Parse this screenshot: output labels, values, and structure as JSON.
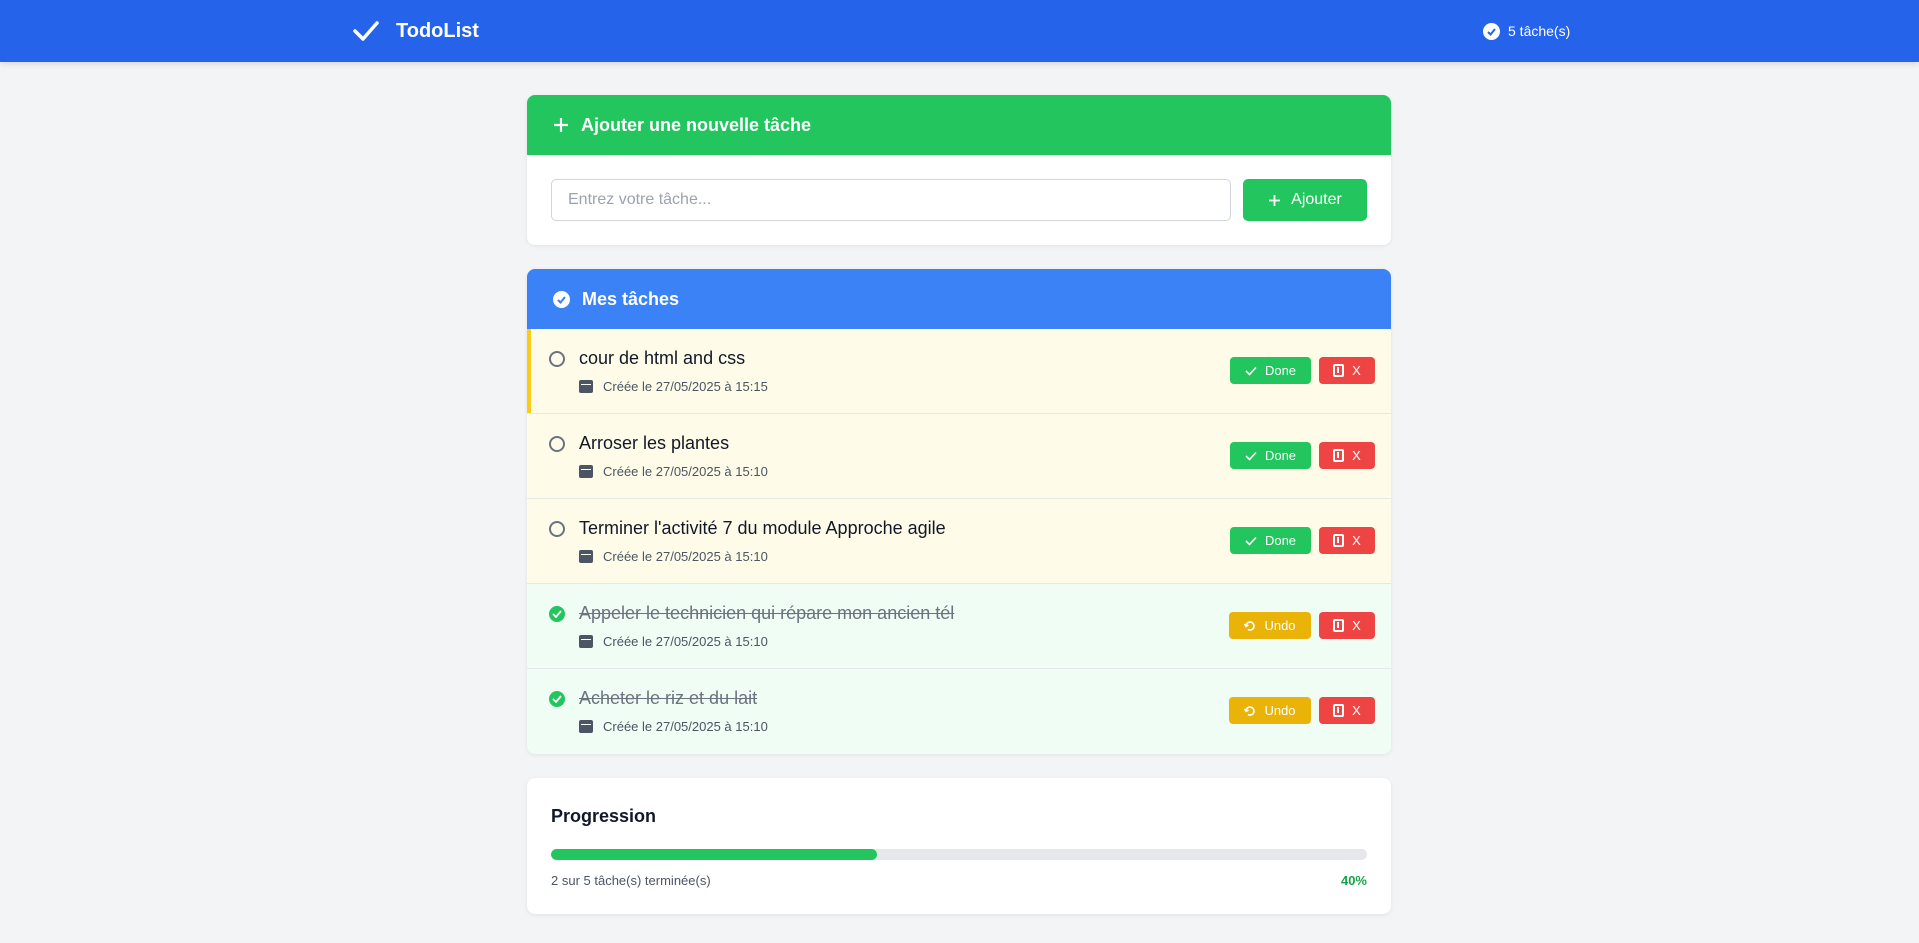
{
  "app": {
    "name": "TodoList",
    "task_count_label": "5 tâche(s)"
  },
  "add_section": {
    "title": "Ajouter une nouvelle tâche",
    "input_placeholder": "Entrez votre tâche...",
    "input_value": "",
    "add_button_label": "Ajouter"
  },
  "tasks_section": {
    "title": "Mes tâches",
    "tasks": [
      {
        "title": "cour de html and css",
        "created": "Créée le 27/05/2025 à 15:15",
        "done": false,
        "action_label": "Done",
        "delete_label": "X"
      },
      {
        "title": "Arroser les plantes",
        "created": "Créée le 27/05/2025 à 15:10",
        "done": false,
        "action_label": "Done",
        "delete_label": "X"
      },
      {
        "title": "Terminer l'activité 7 du module Approche agile",
        "created": "Créée le 27/05/2025 à 15:10",
        "done": false,
        "action_label": "Done",
        "delete_label": "X"
      },
      {
        "title": "Appeler le technicien qui répare mon ancien tél",
        "created": "Créée le 27/05/2025 à 15:10",
        "done": true,
        "action_label": "Undo",
        "delete_label": "X"
      },
      {
        "title": "Acheter le riz et du lait",
        "created": "Créée le 27/05/2025 à 15:10",
        "done": true,
        "action_label": "Undo",
        "delete_label": "X"
      }
    ]
  },
  "progress": {
    "title": "Progression",
    "summary": "2 sur 5 tâche(s) terminée(s)",
    "percent_label": "40%",
    "fraction": 0.4
  },
  "colors": {
    "navbar": "#2563eb",
    "add_header": "#22c55e",
    "tasks_header": "#3b82f6",
    "done_button": "#22c55e",
    "undo_button": "#eab308",
    "delete_button": "#ef4444"
  }
}
